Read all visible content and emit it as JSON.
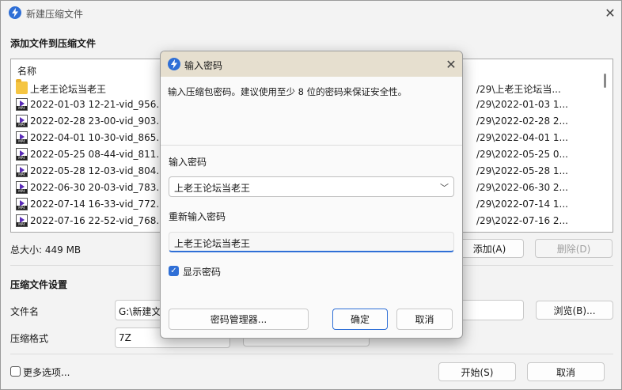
{
  "main_window": {
    "title": "新建压缩文件",
    "add_files_heading": "添加文件到压缩文件",
    "list_header": "名称",
    "files": [
      {
        "name": "上老王论坛当老王",
        "path": "/29\\上老王论坛当...",
        "kind": "folder"
      },
      {
        "name": "2022-01-03 12-21-vid_956.m",
        "path": "/29\\2022-01-03 1...",
        "kind": "mp4"
      },
      {
        "name": "2022-02-28 23-00-vid_903.m",
        "path": "/29\\2022-02-28 2...",
        "kind": "mp4"
      },
      {
        "name": "2022-04-01 10-30-vid_865.m",
        "path": "/29\\2022-04-01 1...",
        "kind": "mp4"
      },
      {
        "name": "2022-05-25 08-44-vid_811.m",
        "path": "/29\\2022-05-25 0...",
        "kind": "mp4"
      },
      {
        "name": "2022-05-28 12-03-vid_804.m",
        "path": "/29\\2022-05-28 1...",
        "kind": "mp4"
      },
      {
        "name": "2022-06-30 20-03-vid_783.m",
        "path": "/29\\2022-06-30 2...",
        "kind": "mp4"
      },
      {
        "name": "2022-07-14 16-33-vid_772.m",
        "path": "/29\\2022-07-14 1...",
        "kind": "mp4"
      },
      {
        "name": "2022-07-16 22-52-vid_768.m",
        "path": "/29\\2022-07-16 2...",
        "kind": "mp4"
      }
    ],
    "total_size": "总大小: 449 MB",
    "add_button": "添加(A)",
    "delete_button": "删除(D)",
    "settings_heading": "压缩文件设置",
    "filename_label": "文件名",
    "filename_value": "G:\\新建文",
    "browse_button": "浏览(B)...",
    "format_label": "压缩格式",
    "format_value": "7Z",
    "more_options": "更多选项...",
    "start_button": "开始(S)",
    "cancel_button": "取消"
  },
  "dialog": {
    "title": "输入密码",
    "description": "输入压缩包密码。建议使用至少 8 位的密码来保证安全性。",
    "password_label": "输入密码",
    "password_value": "上老王论坛当老王",
    "confirm_label": "重新输入密码",
    "confirm_value": "上老王论坛当老王",
    "show_password_label": "显示密码",
    "show_password_checked": true,
    "manager_button": "密码管理器...",
    "ok_button": "确定",
    "cancel_button": "取消"
  },
  "colors": {
    "accent": "#2f6fd6",
    "dialog_titlebar": "#e6dfcf"
  }
}
